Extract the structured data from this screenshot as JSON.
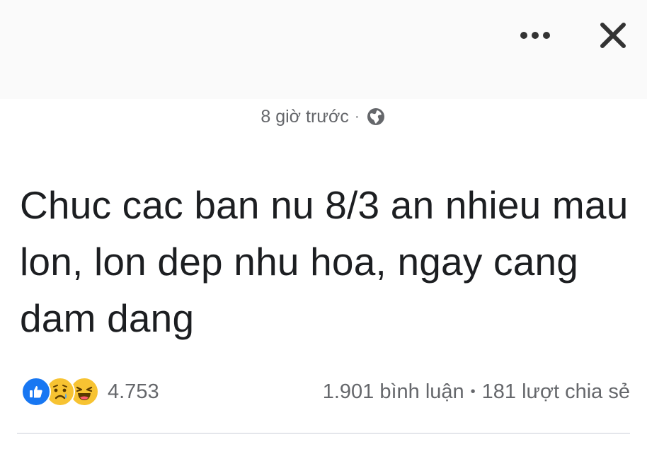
{
  "header": {
    "more_icon": "more-horizontal-icon",
    "close_icon": "close-icon"
  },
  "post": {
    "timestamp": "8 giờ trước",
    "separator": "·",
    "privacy_icon": "globe-icon",
    "text": "Chuc cac ban nu 8/3 an nhieu mau lon, lon dep nhu hoa, ngay cang dam dang"
  },
  "stats": {
    "reaction_icons": [
      "like-icon",
      "sad-icon",
      "haha-icon"
    ],
    "reaction_count": "4.753",
    "comments": "1.901 bình luận",
    "separator": "•",
    "shares": "181 lượt chia sẻ"
  },
  "colors": {
    "like_blue": "#1877f2",
    "emoji_yellow": "#f7c332",
    "muted_text": "#65676b"
  }
}
